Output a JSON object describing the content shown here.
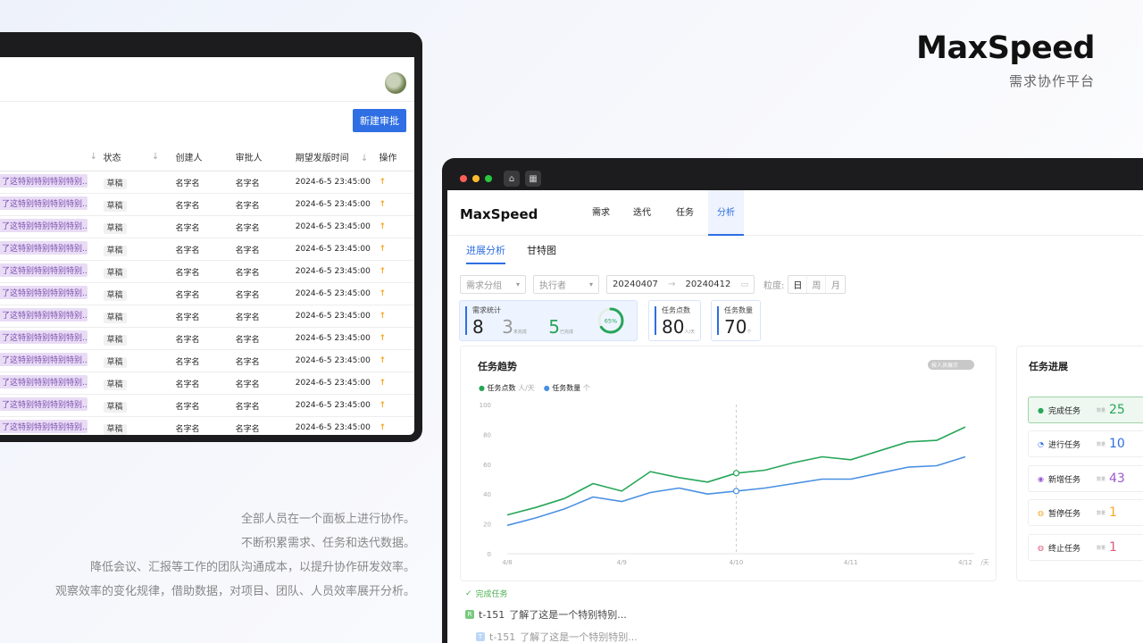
{
  "brand": {
    "logo": "MaxSpeed",
    "subtitle": "需求协作平台"
  },
  "tagline": [
    "全部人员在一个面板上进行协作。",
    "不断积累需求、任务和迭代数据。",
    "降低会议、汇报等工作的团队沟通成本，以提升协作研发效率。",
    "观察效率的变化规律，借助数据，对项目、团队、人员效率展开分析。"
  ],
  "left_window": {
    "new_button": "新建审批",
    "columns": {
      "status": "状态",
      "creator": "创建人",
      "approver": "审批人",
      "expected_time": "期望发版时间",
      "action": "操作"
    },
    "rows": [
      {
        "title": "了这特别特别特别特别...",
        "status": "草稿",
        "creator": "名字名",
        "approver": "名字名",
        "time": "2024-6-5 23:45:00",
        "action": "↑"
      },
      {
        "title": "了这特别特别特别特别...",
        "status": "草稿",
        "creator": "名字名",
        "approver": "名字名",
        "time": "2024-6-5 23:45:00",
        "action": "↑"
      },
      {
        "title": "了这特别特别特别特别...",
        "status": "草稿",
        "creator": "名字名",
        "approver": "名字名",
        "time": "2024-6-5 23:45:00",
        "action": "↑"
      },
      {
        "title": "了这特别特别特别特别...",
        "status": "草稿",
        "creator": "名字名",
        "approver": "名字名",
        "time": "2024-6-5 23:45:00",
        "action": "↑"
      },
      {
        "title": "了这特别特别特别特别...",
        "status": "草稿",
        "creator": "名字名",
        "approver": "名字名",
        "time": "2024-6-5 23:45:00",
        "action": "↑"
      },
      {
        "title": "了这特别特别特别特别...",
        "status": "草稿",
        "creator": "名字名",
        "approver": "名字名",
        "time": "2024-6-5 23:45:00",
        "action": "↑"
      },
      {
        "title": "了这特别特别特别特别...",
        "status": "草稿",
        "creator": "名字名",
        "approver": "名字名",
        "time": "2024-6-5 23:45:00",
        "action": "↑"
      },
      {
        "title": "了这特别特别特别特别...",
        "status": "草稿",
        "creator": "名字名",
        "approver": "名字名",
        "time": "2024-6-5 23:45:00",
        "action": "↑"
      },
      {
        "title": "了这特别特别特别特别...",
        "status": "草稿",
        "creator": "名字名",
        "approver": "名字名",
        "time": "2024-6-5 23:45:00",
        "action": "↑"
      },
      {
        "title": "了这特别特别特别特别...",
        "status": "草稿",
        "creator": "名字名",
        "approver": "名字名",
        "time": "2024-6-5 23:45:00",
        "action": "↑"
      },
      {
        "title": "了这特别特别特别特别...",
        "status": "草稿",
        "creator": "名字名",
        "approver": "名字名",
        "time": "2024-6-5 23:45:00",
        "action": "↑"
      },
      {
        "title": "了这特别特别特别特别...",
        "status": "草稿",
        "creator": "名字名",
        "approver": "名字名",
        "time": "2024-6-5 23:45:00",
        "action": "↑"
      }
    ]
  },
  "right_window": {
    "logo": "MaxSpeed",
    "nav": [
      "需求",
      "迭代",
      "任务",
      "分析"
    ],
    "nav_active": "分析",
    "sub_tabs": [
      "进展分析",
      "甘特图"
    ],
    "filters": {
      "group_placeholder": "需求分组",
      "executor_placeholder": "执行者",
      "date_start": "20240407",
      "date_end": "20240412",
      "granularity_label": "粒度:",
      "granularity": [
        "日",
        "周",
        "月"
      ],
      "granularity_selected": "日"
    },
    "stats": {
      "demand_label": "需求统计",
      "demand_total": "8",
      "demand_unfinished": "3",
      "demand_unfinished_unit": "未完成",
      "demand_finished": "5",
      "demand_finished_unit": "已完成",
      "demand_percent": "65%",
      "demand_percent_value": 65,
      "points_label": "任务点数",
      "points_value": "80",
      "points_unit": "人/天",
      "count_label": "任务数量",
      "count_value": "70",
      "count_unit": "个"
    },
    "trend": {
      "title": "任务趋势",
      "toggle_label": "按人员展示",
      "legend": [
        {
          "name": "任务点数",
          "unit": "人/天",
          "color": "#27a659"
        },
        {
          "name": "任务数量",
          "unit": "个",
          "color": "#4a90e2"
        }
      ]
    },
    "progress": {
      "title": "进展",
      "full_title": "任务进展",
      "label_small": "数量",
      "items": [
        {
          "label": "完成任务",
          "value": "25",
          "color": "#27a659",
          "icon": "check-circle-icon"
        },
        {
          "label": "进行任务",
          "value": "10",
          "color": "#2f6fe3",
          "icon": "clock-icon"
        },
        {
          "label": "新增任务",
          "value": "43",
          "color": "#9b59d0",
          "icon": "plus-circle-icon"
        },
        {
          "label": "暂停任务",
          "value": "1",
          "color": "#f5a623",
          "icon": "pause-circle-icon"
        },
        {
          "label": "终止任务",
          "value": "1",
          "color": "#e05a7a",
          "icon": "stop-circle-icon"
        }
      ]
    },
    "done_list": {
      "header": "完成任务",
      "items": [
        {
          "id": "t-151",
          "title": "了解了这是一个特别特别..."
        },
        {
          "id": "t-151",
          "title": "了解了这是一个特别特别..."
        }
      ]
    }
  },
  "chart_data": {
    "type": "line",
    "title": "任务趋势",
    "x_ticks": [
      "4/8",
      "4/9",
      "4/10",
      "4/11",
      "4/12"
    ],
    "x_unit": "/天",
    "ylim": [
      0,
      100
    ],
    "y_ticks": [
      0,
      20,
      40,
      60,
      80,
      100
    ],
    "grid": false,
    "x": [
      0,
      0.25,
      0.5,
      0.75,
      1,
      1.25,
      1.5,
      1.75,
      2,
      2.25,
      2.5,
      2.75,
      3,
      3.25,
      3.5,
      3.75,
      4
    ],
    "series": [
      {
        "name": "任务点数",
        "color": "#27a659",
        "values": [
          26,
          31,
          37,
          47,
          42,
          55,
          51,
          48,
          54,
          56,
          61,
          65,
          63,
          69,
          75,
          76,
          85
        ]
      },
      {
        "name": "任务数量",
        "color": "#4a90e2",
        "values": [
          19,
          24,
          30,
          38,
          35,
          41,
          44,
          40,
          42,
          44,
          47,
          50,
          50,
          54,
          58,
          59,
          65
        ]
      }
    ],
    "highlight_x": 2
  }
}
